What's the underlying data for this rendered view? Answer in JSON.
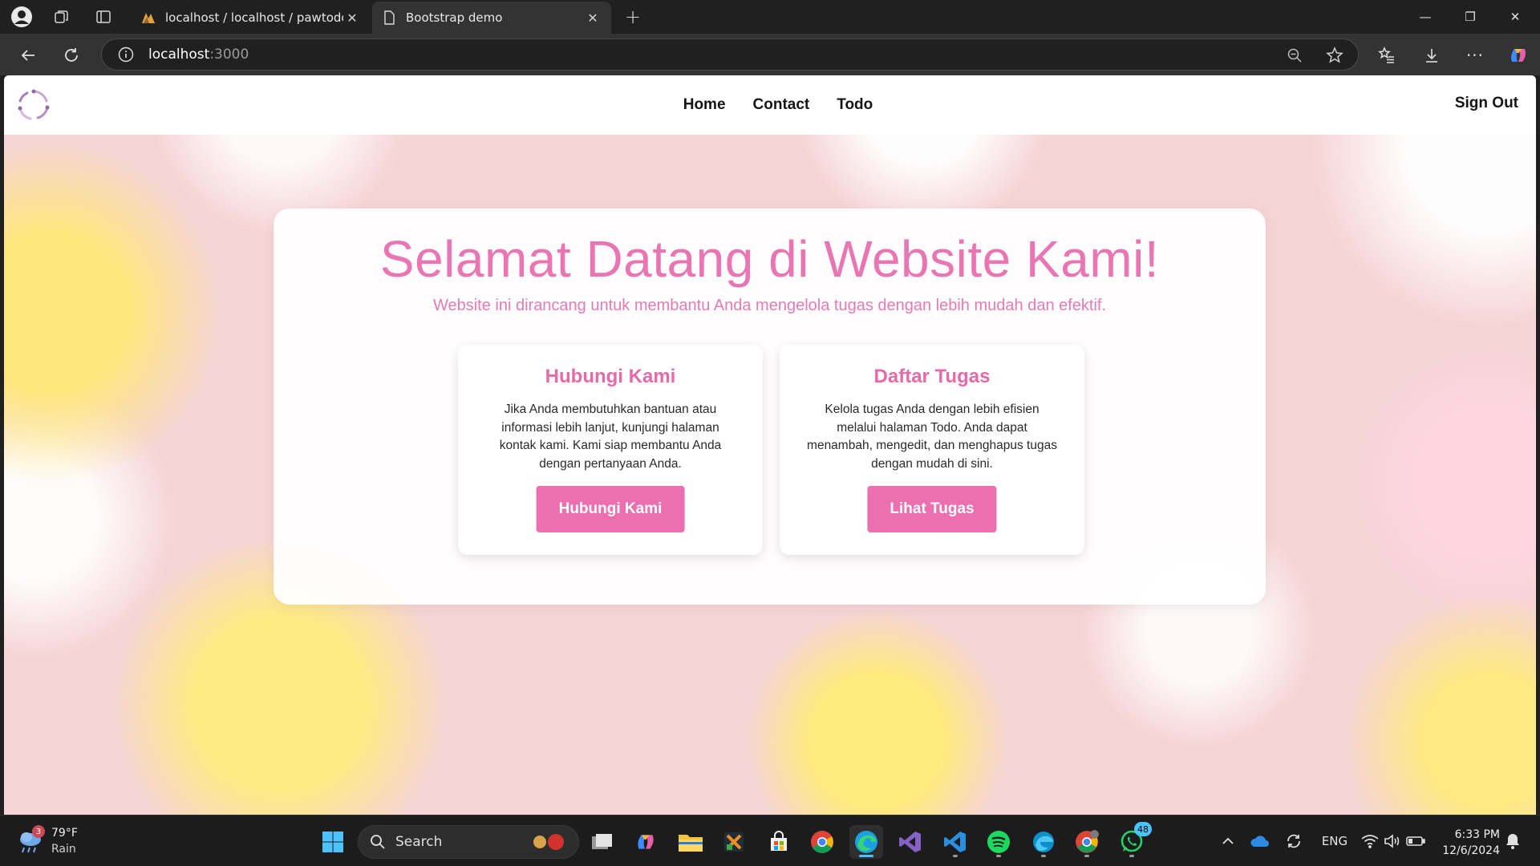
{
  "browser": {
    "tabs": [
      {
        "title": "localhost / localhost / pawtodo / ",
        "active": false
      },
      {
        "title": "Bootstrap demo",
        "active": true
      }
    ],
    "address": {
      "host": "localhost",
      "port": ":3000"
    }
  },
  "navbar": {
    "links": [
      "Home",
      "Contact",
      "Todo"
    ],
    "signout": "Sign Out"
  },
  "hero": {
    "title": "Selamat Datang di Website Kami!",
    "subtitle": "Website ini dirancang untuk membantu Anda mengelola tugas dengan lebih mudah dan efektif."
  },
  "cards": [
    {
      "title": "Hubungi Kami",
      "text": "Jika Anda membutuhkan bantuan atau informasi lebih lanjut, kunjungi halaman kontak kami. Kami siap membantu Anda dengan pertanyaan Anda.",
      "button": "Hubungi Kami"
    },
    {
      "title": "Daftar Tugas",
      "text": "Kelola tugas Anda dengan lebih efisien melalui halaman Todo. Anda dapat menambah, mengedit, dan menghapus tugas dengan mudah di sini.",
      "button": "Lihat Tugas"
    }
  ],
  "taskbar": {
    "weather": {
      "badge": "3",
      "temp": "79°F",
      "condition": "Rain"
    },
    "search_label": "Search",
    "whatsapp_badge": "48",
    "language": "ENG",
    "time": "6:33 PM",
    "date": "12/6/2024"
  },
  "colors": {
    "accent_pink": "#ec6fb0",
    "title_pink": "#e976b3",
    "page_background": "#f6d4d6",
    "edge_blue": "#4cc2ff"
  }
}
